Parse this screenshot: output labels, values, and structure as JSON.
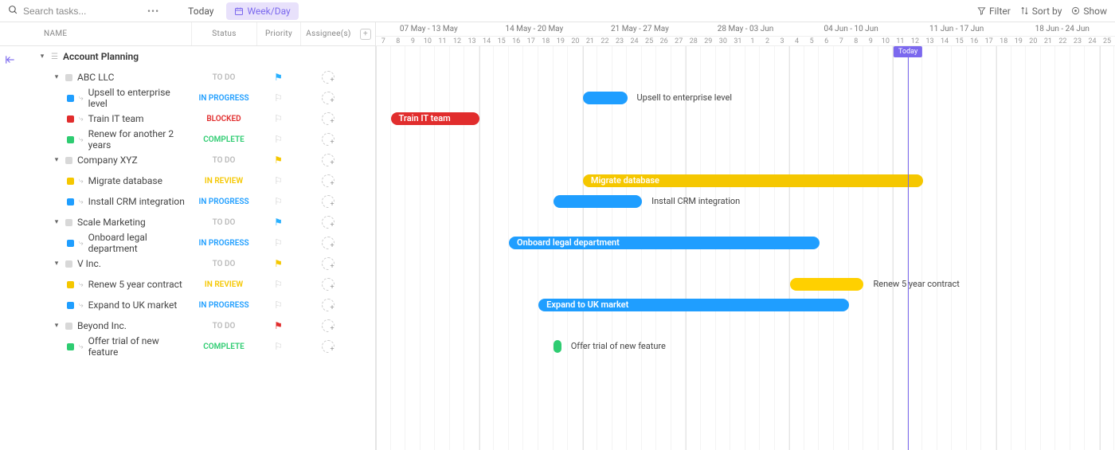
{
  "toolbar": {
    "search_placeholder": "Search tasks...",
    "more": "•••",
    "today": "Today",
    "weekday": "Week/Day",
    "filter": "Filter",
    "sortby": "Sort by",
    "show": "Show"
  },
  "columns": {
    "name": "NAME",
    "status": "Status",
    "priority": "Priority",
    "assignee": "Assignee(s)"
  },
  "status_labels": {
    "todo": "TO DO",
    "progress": "IN PROGRESS",
    "blocked": "BLOCKED",
    "complete": "COMPLETE",
    "review": "IN REVIEW"
  },
  "gantt": {
    "start_day_index": 7,
    "days": [
      "7",
      "8",
      "9",
      "10",
      "11",
      "12",
      "13",
      "14",
      "15",
      "16",
      "17",
      "18",
      "19",
      "20",
      "21",
      "22",
      "23",
      "24",
      "25",
      "26",
      "27",
      "28",
      "29",
      "30",
      "31",
      "1",
      "2",
      "3",
      "4",
      "5",
      "6",
      "7",
      "8",
      "9",
      "10",
      "11",
      "12",
      "13",
      "14",
      "15",
      "16",
      "17",
      "18",
      "19",
      "20",
      "21",
      "22",
      "23",
      "24",
      "25"
    ],
    "weeks": [
      "07 May - 13 May",
      "14 May - 20 May",
      "21 May - 27 May",
      "28 May - 03 Jun",
      "04 Jun - 10 Jun",
      "11 Jun - 17 Jun",
      "18 Jun - 24 Jun"
    ],
    "today_label": "Today",
    "today_day_index": 36
  },
  "tree": [
    {
      "type": "group",
      "indent": 0,
      "name": "Account Planning"
    },
    {
      "type": "parent",
      "indent": 1,
      "name": "ABC LLC",
      "status": "todo",
      "priority_color": "#29b0ff"
    },
    {
      "type": "task",
      "indent": 2,
      "name": "Upsell to enterprise level",
      "status": "progress",
      "sq": "sq-blue",
      "bar": {
        "start": 14,
        "end": 17,
        "color": "c-blue",
        "label_outside": true
      }
    },
    {
      "type": "task",
      "indent": 2,
      "name": "Train IT team",
      "status": "blocked",
      "sq": "sq-red",
      "bar": {
        "start": 1,
        "end": 7,
        "color": "c-red",
        "label_inside": true
      }
    },
    {
      "type": "task",
      "indent": 2,
      "name": "Renew for another 2 years",
      "status": "complete",
      "sq": "sq-green"
    },
    {
      "type": "parent",
      "indent": 1,
      "name": "Company XYZ",
      "status": "todo",
      "priority_color": "#f5c700"
    },
    {
      "type": "task",
      "indent": 2,
      "name": "Migrate database",
      "status": "review",
      "sq": "sq-yellow",
      "bar": {
        "start": 14,
        "end": 37,
        "color": "c-yellow",
        "label_inside": true
      }
    },
    {
      "type": "task",
      "indent": 2,
      "name": "Install CRM integration",
      "status": "progress",
      "sq": "sq-blue",
      "bar": {
        "start": 12,
        "end": 18,
        "color": "c-blue",
        "label_outside": true
      }
    },
    {
      "type": "parent",
      "indent": 1,
      "name": "Scale Marketing",
      "status": "todo",
      "priority_color": "#29b0ff"
    },
    {
      "type": "task",
      "indent": 2,
      "name": "Onboard legal department",
      "status": "progress",
      "sq": "sq-blue",
      "bar": {
        "start": 9,
        "end": 30,
        "color": "c-blue",
        "label_inside": true
      }
    },
    {
      "type": "parent",
      "indent": 1,
      "name": "V Inc.",
      "status": "todo",
      "priority_color": "#f5c700"
    },
    {
      "type": "task",
      "indent": 2,
      "name": "Renew 5 year contract",
      "status": "review",
      "sq": "sq-yellow",
      "bar": {
        "start": 28,
        "end": 33,
        "color": "c-yellow-2",
        "label_outside": true
      }
    },
    {
      "type": "task",
      "indent": 2,
      "name": "Expand to UK market",
      "status": "progress",
      "sq": "sq-blue",
      "bar": {
        "start": 11,
        "end": 32,
        "color": "c-blue",
        "label_inside": true
      }
    },
    {
      "type": "parent",
      "indent": 1,
      "name": "Beyond Inc.",
      "status": "todo",
      "priority_color": "#e12d2d"
    },
    {
      "type": "task",
      "indent": 2,
      "name": "Offer trial of new feature",
      "status": "complete",
      "sq": "sq-green",
      "bar": {
        "start": 12,
        "end": 12.4,
        "color": "c-green",
        "label_outside": true
      }
    }
  ]
}
